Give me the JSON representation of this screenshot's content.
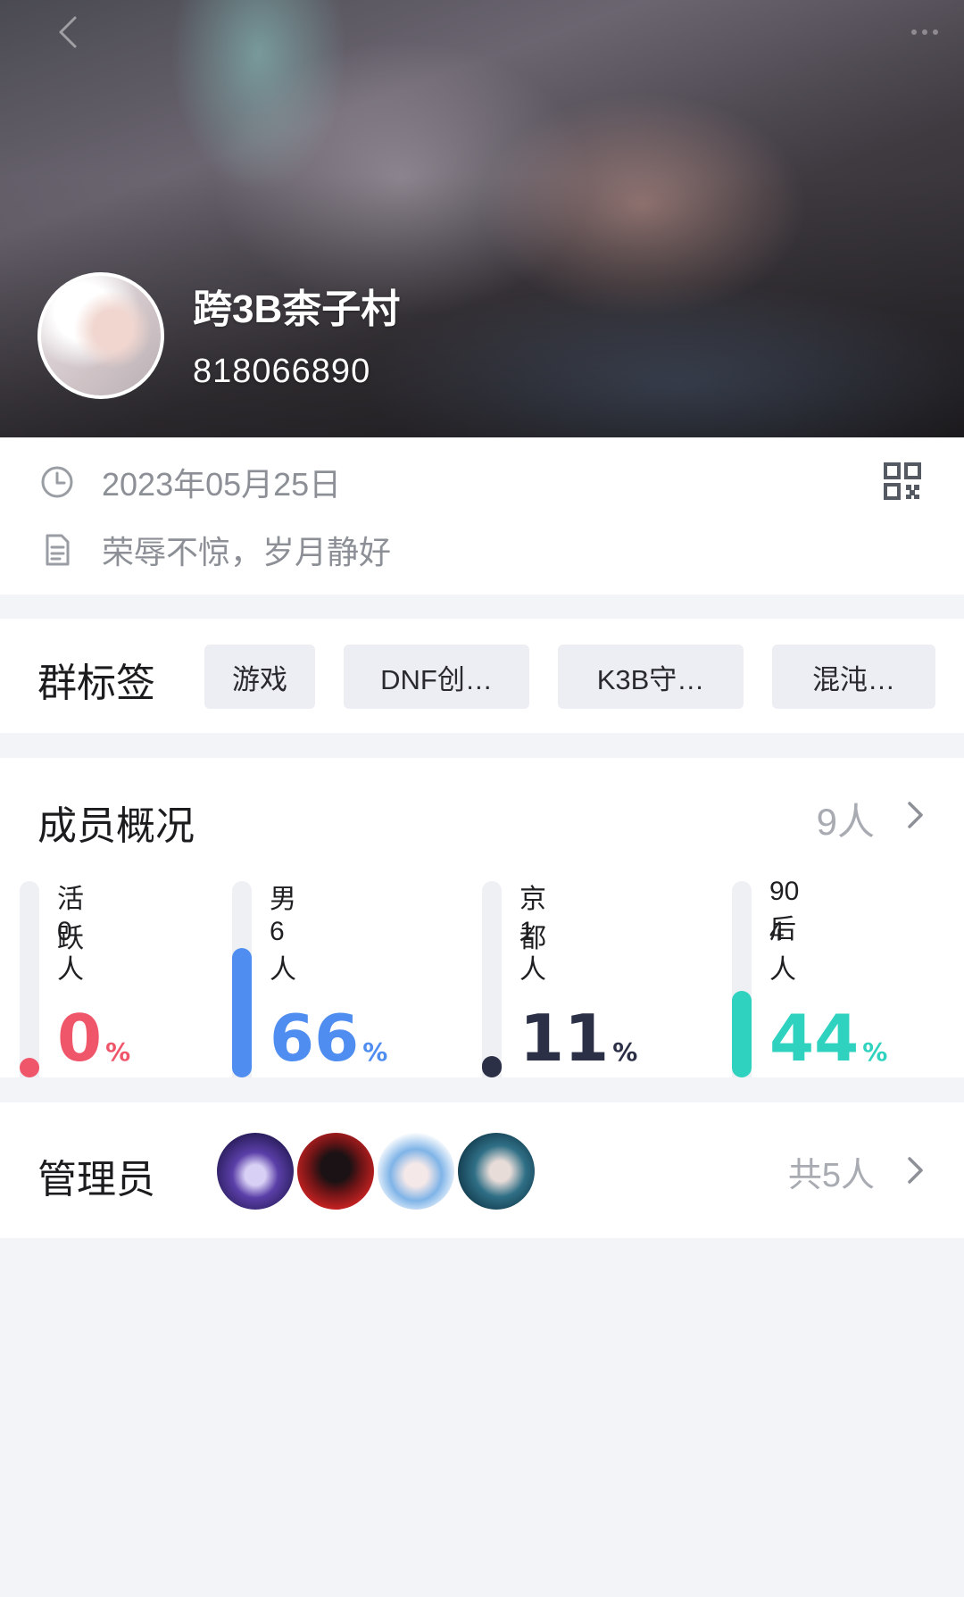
{
  "header": {
    "group_name": "跨3B柰子村",
    "group_id": "818066890",
    "back_icon": "chevron-left-icon",
    "more_icon": "more-icon"
  },
  "info": {
    "created_date": "2023年05月25日",
    "description": "荣辱不惊，岁月静好",
    "date_icon": "clock-icon",
    "description_icon": "document-icon",
    "qr_icon": "qr-code-icon"
  },
  "tags": {
    "title": "群标签",
    "items": [
      "游戏",
      "DNF创…",
      "K3B守…",
      "混沌…"
    ]
  },
  "members": {
    "title": "成员概况",
    "count": "9人",
    "stats": [
      {
        "label": "活跃",
        "count": "0人",
        "percent": "0",
        "percent_sign": "%",
        "fill": 0.0,
        "color": "#f0566a"
      },
      {
        "label": "男",
        "count": "6人",
        "percent": "66",
        "percent_sign": "%",
        "fill": 0.66,
        "color": "#4f8ef0"
      },
      {
        "label": "京都",
        "count": "1人",
        "percent": "11",
        "percent_sign": "%",
        "fill": 0.11,
        "color": "#2b3046"
      },
      {
        "label": "90后",
        "count": "4人",
        "percent": "44",
        "percent_sign": "%",
        "fill": 0.44,
        "color": "#2fd2bf"
      }
    ]
  },
  "admins": {
    "title": "管理员",
    "count": "共5人"
  }
}
